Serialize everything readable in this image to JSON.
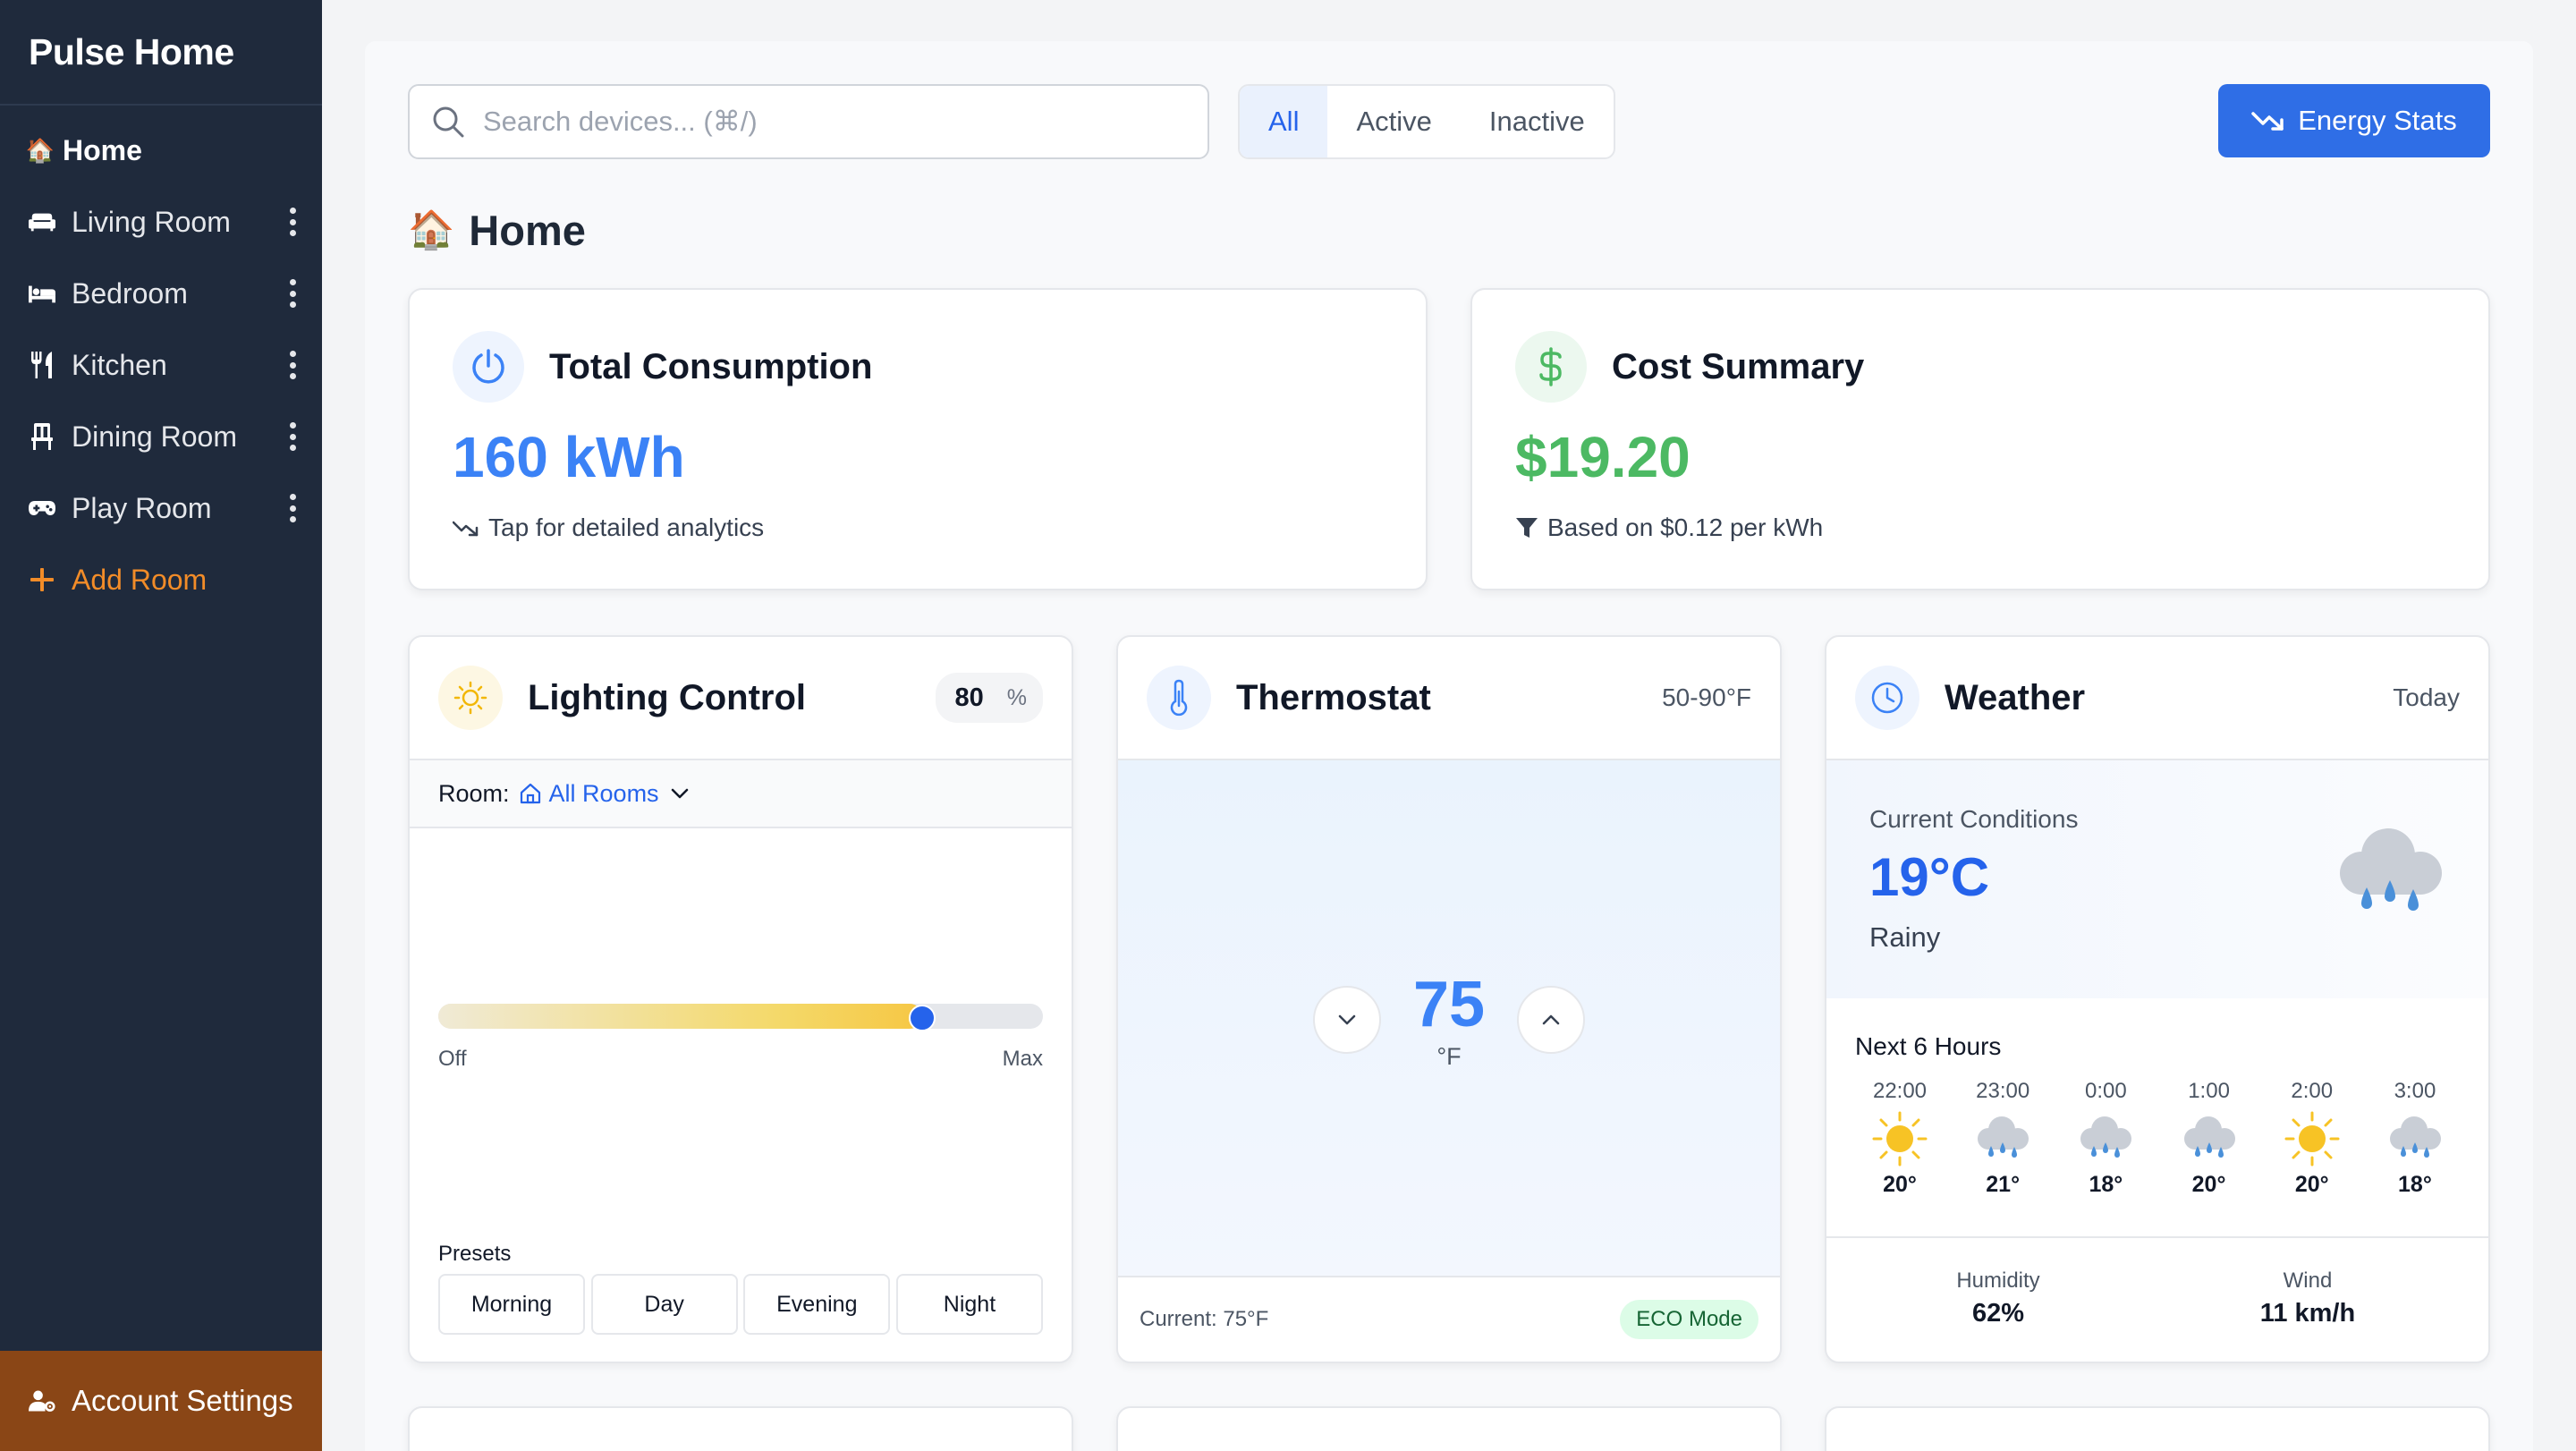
{
  "app": {
    "title": "Pulse Home"
  },
  "sidebar": {
    "items": [
      {
        "label": "Home",
        "icon": "house-emoji-icon",
        "active": true
      },
      {
        "label": "Living Room",
        "icon": "couch-icon"
      },
      {
        "label": "Bedroom",
        "icon": "bed-icon"
      },
      {
        "label": "Kitchen",
        "icon": "utensils-icon"
      },
      {
        "label": "Dining Room",
        "icon": "chair-icon"
      },
      {
        "label": "Play Room",
        "icon": "gamepad-icon"
      }
    ],
    "add_room": "Add Room",
    "account": "Account Settings"
  },
  "toolbar": {
    "search_placeholder": "Search devices... (⌘/)",
    "filters": [
      "All",
      "Active",
      "Inactive"
    ],
    "active_filter": "All",
    "energy_button": "Energy Stats"
  },
  "page": {
    "title": "Home",
    "emoji": "🏠"
  },
  "consumption": {
    "title": "Total Consumption",
    "value": "160 kWh",
    "note": "Tap for detailed analytics",
    "accent": "#3b82f6"
  },
  "cost": {
    "title": "Cost Summary",
    "value": "$19.20",
    "note": "Based on $0.12 per kWh",
    "accent": "#4cb963"
  },
  "lighting": {
    "title": "Lighting Control",
    "value": "80",
    "unit": "%",
    "room_label": "Room:",
    "room_value": "All Rooms",
    "level": 0.8,
    "min_label": "Off",
    "max_label": "Max",
    "presets_label": "Presets",
    "presets": [
      "Morning",
      "Day",
      "Evening",
      "Night"
    ]
  },
  "thermostat": {
    "title": "Thermostat",
    "range": "50-90°F",
    "value": "75",
    "unit": "°F",
    "current": "Current: 75°F",
    "mode": "ECO Mode"
  },
  "weather": {
    "title": "Weather",
    "meta": "Today",
    "current_label": "Current Conditions",
    "temp": "19°C",
    "condition": "Rainy",
    "next_label": "Next 6 Hours",
    "hours": [
      {
        "time": "22:00",
        "icon": "sun",
        "temp": "20°"
      },
      {
        "time": "23:00",
        "icon": "rain",
        "temp": "21°"
      },
      {
        "time": "0:00",
        "icon": "rain",
        "temp": "18°"
      },
      {
        "time": "1:00",
        "icon": "rain",
        "temp": "20°"
      },
      {
        "time": "2:00",
        "icon": "sun",
        "temp": "20°"
      },
      {
        "time": "3:00",
        "icon": "rain",
        "temp": "18°"
      }
    ],
    "humidity_label": "Humidity",
    "humidity": "62%",
    "wind_label": "Wind",
    "wind": "11 km/h"
  }
}
